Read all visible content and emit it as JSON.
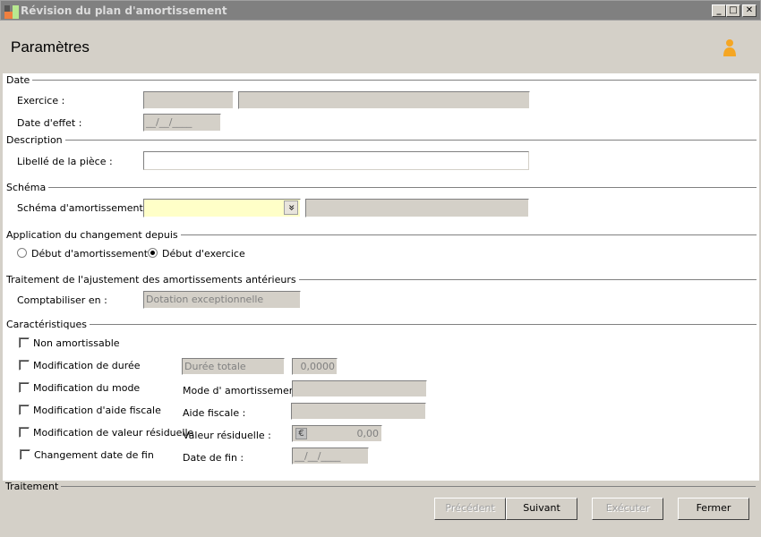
{
  "window": {
    "title": "Révision du plan d'amortissement",
    "minimize": "_",
    "maximize": "□",
    "close": "✕"
  },
  "header": {
    "title": "Paramètres",
    "user_icon": "user-icon"
  },
  "date": {
    "section": "Date",
    "exercice_label": "Exercice :",
    "exercice_code": "",
    "exercice_name": "",
    "date_effet_label": "Date d'effet :",
    "date_effet_value": "__/__/____"
  },
  "description": {
    "section": "Description",
    "libelle_label": "Libellé de la pièce :",
    "libelle_value": ""
  },
  "schema": {
    "section": "Schéma",
    "label": "Schéma d'amortissement :",
    "value": "",
    "dropdown_icon": "»",
    "description": ""
  },
  "application": {
    "section": "Application du changement depuis",
    "options": [
      {
        "label": "Début d'amortissement",
        "selected": false
      },
      {
        "label": "Début d'exercice",
        "selected": true
      }
    ]
  },
  "traitement_ajust": {
    "section": "Traitement de l'ajustement des amortissements antérieurs",
    "label": "Comptabiliser en :",
    "value": "Dotation exceptionnelle"
  },
  "caracteristiques": {
    "section": "Caractéristiques",
    "checks": [
      {
        "label": "Non amortissable",
        "checked": false
      },
      {
        "label": "Modification de durée",
        "checked": false
      },
      {
        "label": "Modification du mode",
        "checked": false
      },
      {
        "label": "Modification d'aide fiscale",
        "checked": false
      },
      {
        "label": "Modification de valeur résiduelle",
        "checked": false
      },
      {
        "label": "Changement date de fin",
        "checked": false
      }
    ],
    "duree_placeholder": "Durée totale",
    "duree_value": "0,0000",
    "mode_label": "Mode d' amortissement :",
    "mode_value": "",
    "aide_label": "Aide fiscale :",
    "aide_value": "",
    "valeur_label": "Valeur résiduelle :",
    "valeur_currency": "€",
    "valeur_value": "0,00",
    "date_fin_label": "Date de fin :",
    "date_fin_value": "__/__/____"
  },
  "footer": {
    "section": "Traitement",
    "buttons": {
      "previous": "Précédent",
      "next": "Suivant",
      "execute": "Exécuter",
      "close": "Fermer"
    }
  }
}
